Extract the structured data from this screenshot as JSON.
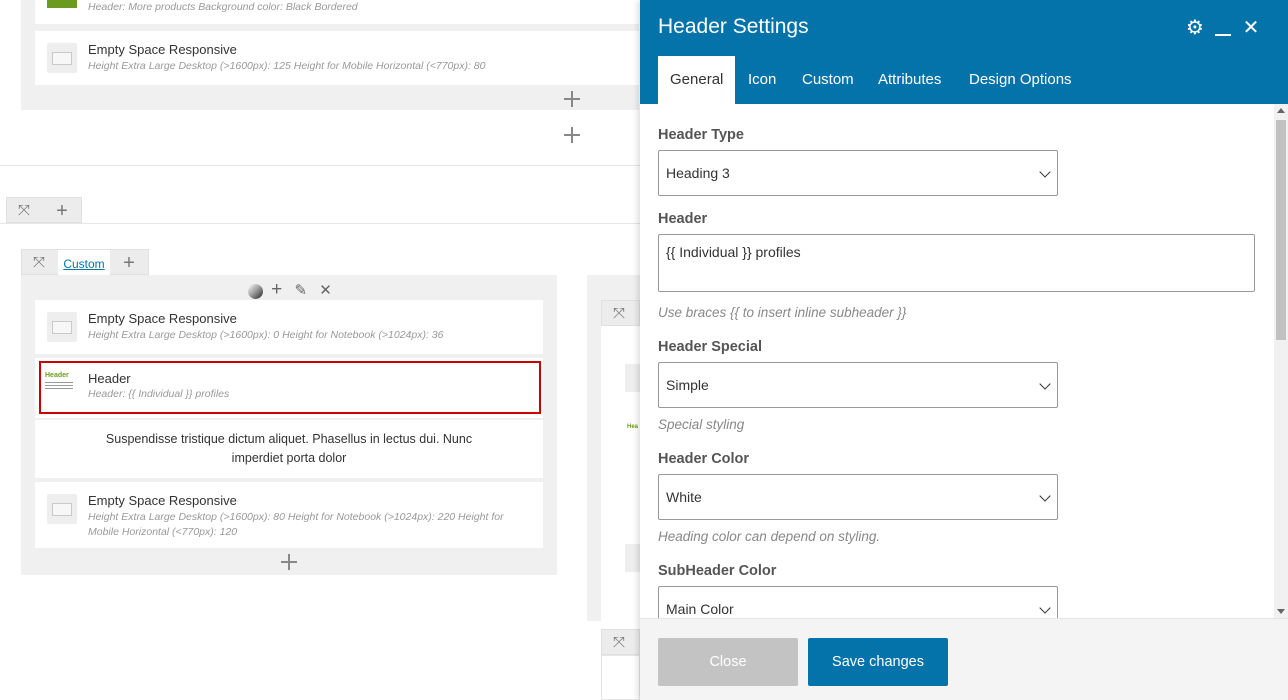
{
  "builder": {
    "top_card_sub": "Header: More products  Background color: Black Bordered",
    "esr1": {
      "title": "Empty Space Responsive",
      "sub": "Height Extra Large Desktop (>1600px): 125  Height for Mobile Horizontal (<770px): 80"
    },
    "custom_label": "Custom",
    "esr2": {
      "title": "Empty Space Responsive",
      "sub": "Height Extra Large Desktop (>1600px): 0  Height for Notebook (>1024px): 36"
    },
    "header_el": {
      "title": "Header",
      "sub": "Header: {{ Individual }} profiles",
      "thumb_word": "Header"
    },
    "text_block": "Suspendisse tristique dictum aliquet. Phasellus in lectus dui. Nunc imperdiet porta dolor",
    "esr3": {
      "title": "Empty Space Responsive",
      "sub": "Height Extra Large Desktop (>1600px): 80  Height for Notebook (>1024px): 220  Height for Mobile Horizontal (<770px): 120"
    }
  },
  "modal": {
    "title": "Header Settings",
    "icons": [
      "gear-icon",
      "minimize-icon",
      "close-icon"
    ],
    "tabs": [
      {
        "label": "General",
        "active": true
      },
      {
        "label": "Icon",
        "active": false
      },
      {
        "label": "Custom",
        "active": false
      },
      {
        "label": "Attributes",
        "active": false
      },
      {
        "label": "Design Options",
        "active": false
      }
    ],
    "fields": {
      "header_type": {
        "label": "Header Type",
        "value": "Heading 3"
      },
      "header": {
        "label": "Header",
        "value": "{{ Individual }} profiles",
        "help": "Use braces {{ to insert inline subheader }}"
      },
      "header_special": {
        "label": "Header Special",
        "value": "Simple",
        "help": "Special styling"
      },
      "header_color": {
        "label": "Header Color",
        "value": "White",
        "help": "Heading color can depend on styling."
      },
      "subheader_color": {
        "label": "SubHeader Color",
        "value": "Main Color"
      }
    },
    "footer": {
      "close_label": "Close",
      "save_label": "Save changes"
    }
  },
  "colors": {
    "accent": "#0473aa",
    "selected_outline": "#cc0000",
    "header_green": "#6a9a1f"
  }
}
